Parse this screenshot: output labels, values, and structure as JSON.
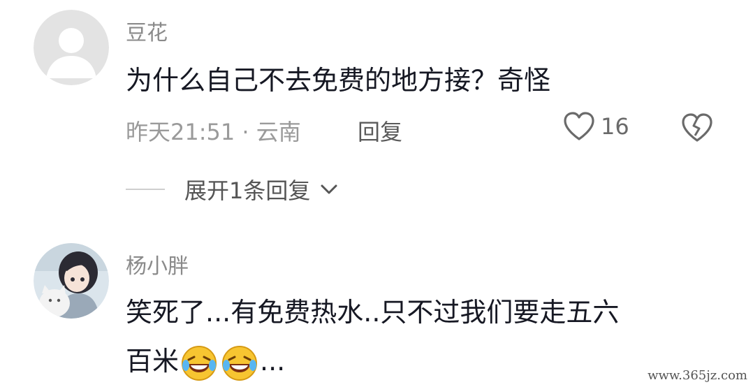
{
  "comments": [
    {
      "username": "豆花",
      "text": "为什么自己不去免费的地方接？奇怪",
      "timestamp": "昨天21:51 · 云南",
      "reply_label": "回复",
      "likes": "16",
      "expand_label": "展开1条回复",
      "avatar": "default-avatar-icon"
    },
    {
      "username": "杨小胖",
      "text_line1": "笑死了...有免费热水..只不过我们要走五六",
      "text_line2": "百米",
      "text_suffix": "...",
      "emojis": [
        "laughing-crying-emoji",
        "laughing-crying-emoji"
      ],
      "avatar": "anime-girl-avatar"
    }
  ],
  "watermark": "www.365jz.com",
  "colors": {
    "text": "#161823",
    "meta": "#9a9a9a",
    "username": "#8a8a8a",
    "emoji_face": "#f7c531"
  }
}
